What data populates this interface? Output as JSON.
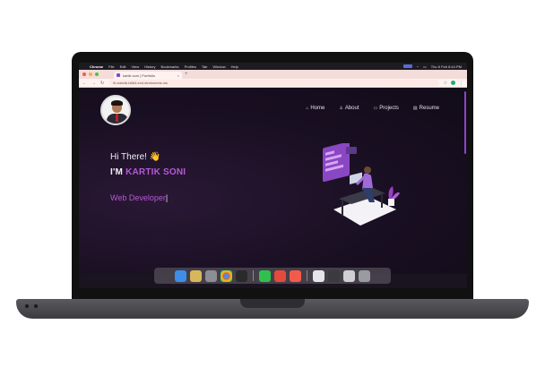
{
  "menubar": {
    "app": "Chrome",
    "items": [
      "File",
      "Edit",
      "View",
      "History",
      "Bookmarks",
      "Profiles",
      "Tab",
      "Window",
      "Help"
    ],
    "clock": "Thu 6 Feb 8:44 PM"
  },
  "browser": {
    "tab_title": "kartik soni | Portfolio",
    "tab_close": "×",
    "new_tab": "+",
    "url": "fb-ededb-b8b4-ecd.devtunnels.ms"
  },
  "nav": {
    "items": [
      {
        "label": "Home",
        "icon": "home-icon"
      },
      {
        "label": "About",
        "icon": "user-icon"
      },
      {
        "label": "Projects",
        "icon": "folder-icon"
      },
      {
        "label": "Resume",
        "icon": "document-icon"
      }
    ]
  },
  "hero": {
    "greeting": "Hi There!",
    "wave": "👋",
    "im_prefix": "I'M",
    "name": "KARTIK SONI",
    "role": "Web Developer",
    "cursor": "|"
  },
  "colors": {
    "accent": "#b35ad6",
    "background": "#190f22",
    "tabbar": "#f3dcd9"
  },
  "dock": {
    "icons": [
      "finder-icon",
      "launchpad-icon",
      "settings-icon",
      "chrome-icon",
      "terminal-icon",
      "whatsapp-icon",
      "recorder-icon",
      "app-icon",
      "preview-icon",
      "window-icon",
      "window-icon",
      "trash-icon"
    ]
  }
}
